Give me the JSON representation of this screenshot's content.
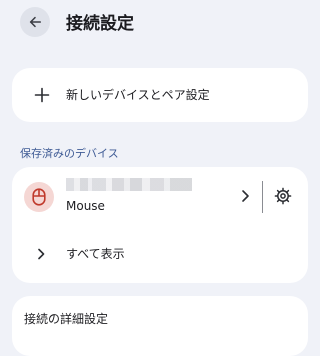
{
  "header": {
    "title": "接続設定"
  },
  "add_device": {
    "label": "新しいデバイスとペア設定"
  },
  "saved_devices": {
    "section_title": "保存済みのデバイス",
    "device": {
      "name": "Mouse",
      "icon": "mouse-icon",
      "avatar_color": "#f5d7d4",
      "icon_color": "#c0392b"
    },
    "show_all_label": "すべて表示"
  },
  "advanced": {
    "label": "接続の詳細設定"
  },
  "colors": {
    "background": "#f0f2f8",
    "card": "#ffffff",
    "section_title": "#3f5b95"
  }
}
